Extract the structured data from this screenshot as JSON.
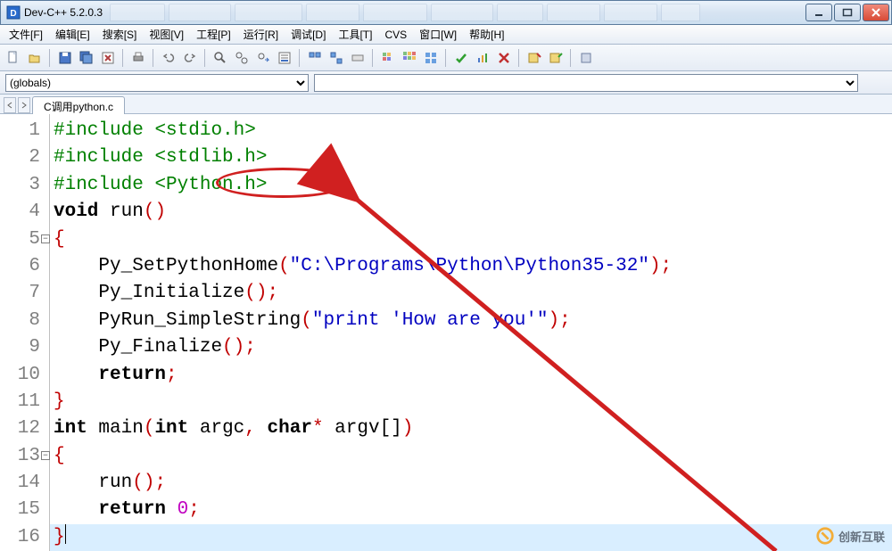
{
  "window": {
    "title": "Dev-C++ 5.2.0.3"
  },
  "menu": {
    "file": "文件[F]",
    "edit": "编辑[E]",
    "search": "搜索[S]",
    "view": "视图[V]",
    "project": "工程[P]",
    "run": "运行[R]",
    "debug": "调试[D]",
    "tools": "工具[T]",
    "cvs": "CVS",
    "window": "窗口[W]",
    "help": "帮助[H]"
  },
  "combos": {
    "scope": "(globals)"
  },
  "tab": {
    "label": "C调用python.c"
  },
  "lines": {
    "1": {
      "n": "1"
    },
    "2": {
      "n": "2"
    },
    "3": {
      "n": "3"
    },
    "4": {
      "n": "4"
    },
    "5": {
      "n": "5"
    },
    "6": {
      "n": "6"
    },
    "7": {
      "n": "7"
    },
    "8": {
      "n": "8"
    },
    "9": {
      "n": "9"
    },
    "10": {
      "n": "10"
    },
    "11": {
      "n": "11"
    },
    "12": {
      "n": "12"
    },
    "13": {
      "n": "13"
    },
    "14": {
      "n": "14"
    },
    "15": {
      "n": "15"
    },
    "16": {
      "n": "16"
    }
  },
  "code": {
    "inc": "#include",
    "hdr1": "<stdio.h>",
    "hdr2": "<stdlib.h>",
    "hdr3": "<Python.h>",
    "void": "void",
    "run_name": "run",
    "lp": "(",
    "rp": ")",
    "lb": "{",
    "rb": "}",
    "semi": ";",
    "py_sethome": "Py_SetPythonHome",
    "str1": "\"C:\\Programs\\Python\\Python35-32\"",
    "py_init": "Py_Initialize",
    "py_runsimple": "PyRun_SimpleString",
    "str2": "\"print 'How are you'\"",
    "py_final": "Py_Finalize",
    "return": "return",
    "int": "int",
    "main": "main",
    "argc": "argc",
    "comma": ",",
    "char": "char",
    "star": "*",
    "argv": "argv[]",
    "run_call": "run",
    "zero": "0"
  },
  "watermark": {
    "text": "创新互联"
  }
}
